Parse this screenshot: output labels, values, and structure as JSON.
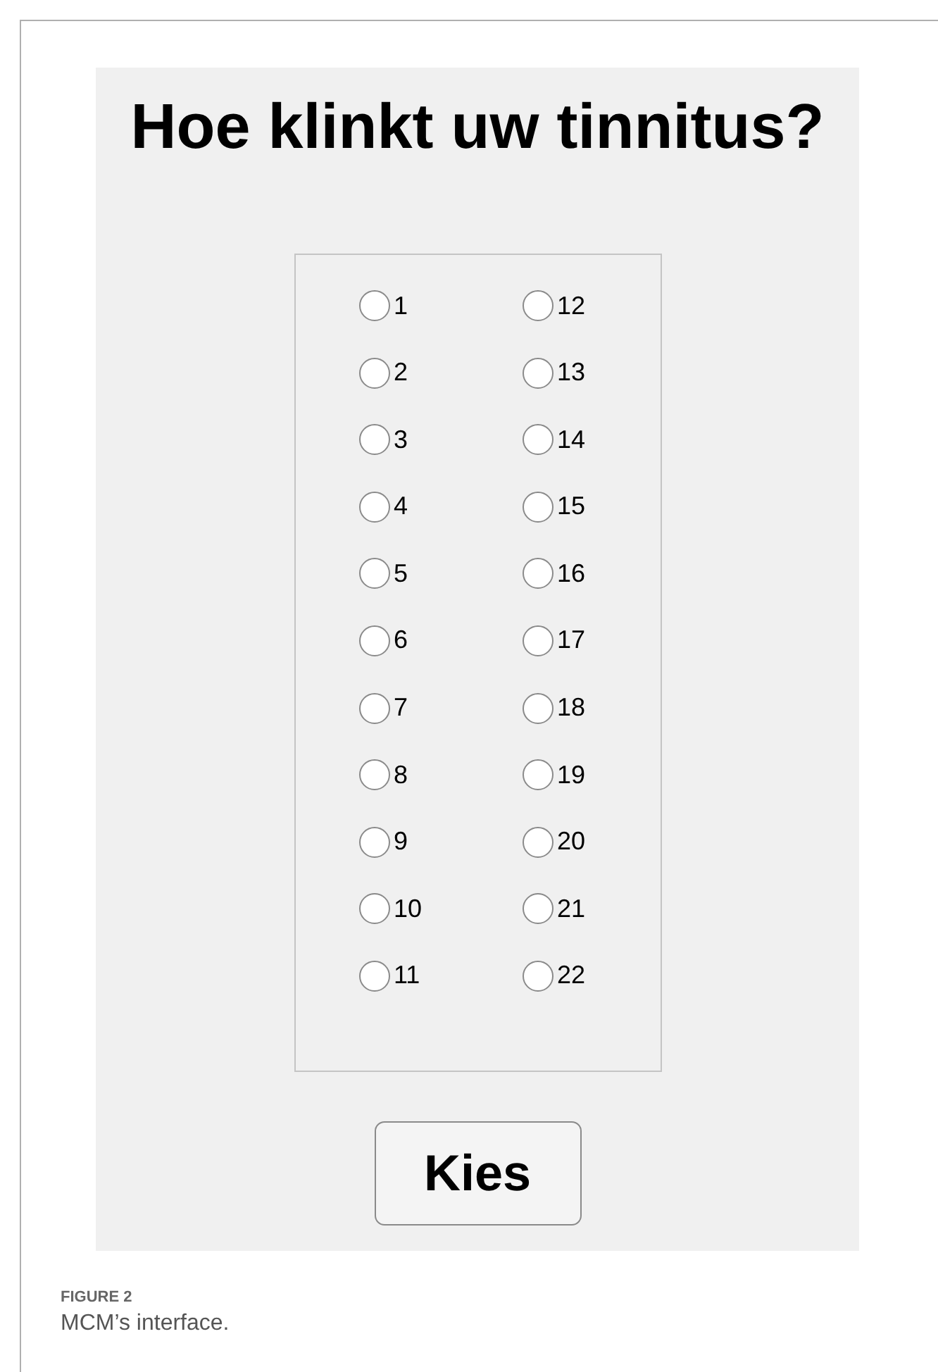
{
  "app": {
    "title": "Hoe klinkt uw tinnitus?",
    "options": [
      {
        "label": "1",
        "selected": false
      },
      {
        "label": "2",
        "selected": false
      },
      {
        "label": "3",
        "selected": false
      },
      {
        "label": "4",
        "selected": false
      },
      {
        "label": "5",
        "selected": false
      },
      {
        "label": "6",
        "selected": false
      },
      {
        "label": "7",
        "selected": false
      },
      {
        "label": "8",
        "selected": false
      },
      {
        "label": "9",
        "selected": false
      },
      {
        "label": "10",
        "selected": false
      },
      {
        "label": "11",
        "selected": false
      },
      {
        "label": "12",
        "selected": false
      },
      {
        "label": "13",
        "selected": false
      },
      {
        "label": "14",
        "selected": false
      },
      {
        "label": "15",
        "selected": false
      },
      {
        "label": "16",
        "selected": false
      },
      {
        "label": "17",
        "selected": false
      },
      {
        "label": "18",
        "selected": false
      },
      {
        "label": "19",
        "selected": false
      },
      {
        "label": "20",
        "selected": false
      },
      {
        "label": "21",
        "selected": false
      },
      {
        "label": "22",
        "selected": false
      }
    ],
    "button": "Kies"
  },
  "caption": {
    "label": "FIGURE 2",
    "text": "MCM’s interface."
  }
}
